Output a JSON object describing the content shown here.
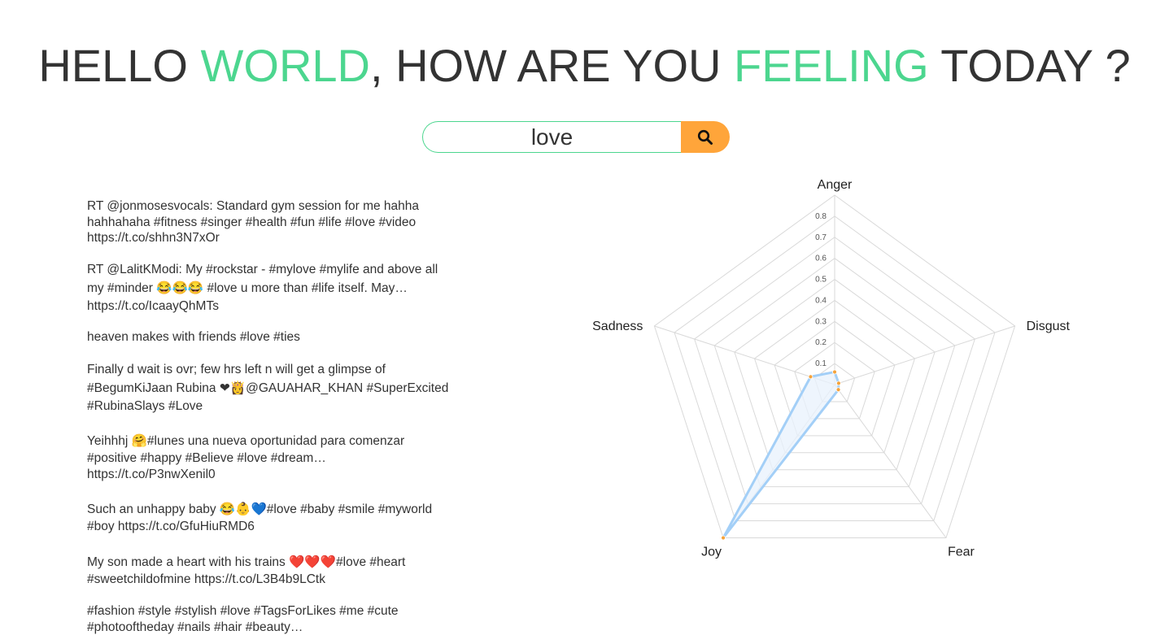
{
  "title": {
    "part1": "HELLO ",
    "accent1": "WORLD",
    "part2": ", HOW ARE YOU ",
    "accent2": "FEELING",
    "part3": " TODAY ?"
  },
  "search": {
    "value": "love",
    "button_icon": "search-icon"
  },
  "colors": {
    "accent": "#4cd68f",
    "button": "#ffa53a",
    "series_line": "#a3cff7",
    "series_fill": "#e8f2fc",
    "point": "#f5a23a"
  },
  "tweets": [
    "RT @jonmosesvocals: Standard gym session for me hahha hahhahaha #fitness #singer #health #fun #life #love #video https://t.co/shhn3N7xOr",
    "RT @LalitKModi: My #rockstar - #mylove #mylife and above all my #minder 😂😂😂 #love u more than #life itself. May… https://t.co/IcaayQhMTs",
    "heaven makes with friends #love #ties",
    "Finally d wait is ovr; few hrs left n will get a glimpse of #BegumKiJaan Rubina ❤👸@GAUAHAR_KHAN #SuperExcited #RubinaSlays #Love",
    "Yeihhhj 🤗#lunes una nueva oportunidad para comenzar #positive #happy #Believe #love #dream… https://t.co/P3nwXenil0",
    "Such an unhappy baby 😂👶💙#love #baby #smile #myworld #boy https://t.co/GfuHiuRMD6",
    "My son made a heart with his trains ❤️❤️❤️#love #heart #sweetchildofmine https://t.co/L3B4b9LCtk",
    "#fashion #style #stylish #love #TagsForLikes #me #cute #photooftheday #nails #hair #beauty…"
  ],
  "chart_data": {
    "type": "radar",
    "axes": [
      "Anger",
      "Disgust",
      "Fear",
      "Joy",
      "Sadness"
    ],
    "ticks": [
      "0.1",
      "0.2",
      "0.3",
      "0.4",
      "0.5",
      "0.6",
      "0.7",
      "0.8"
    ],
    "range": [
      0,
      0.9
    ],
    "grid": true,
    "series": [
      {
        "values": [
          0.06,
          0.02,
          0.03,
          0.9,
          0.12
        ]
      }
    ]
  }
}
